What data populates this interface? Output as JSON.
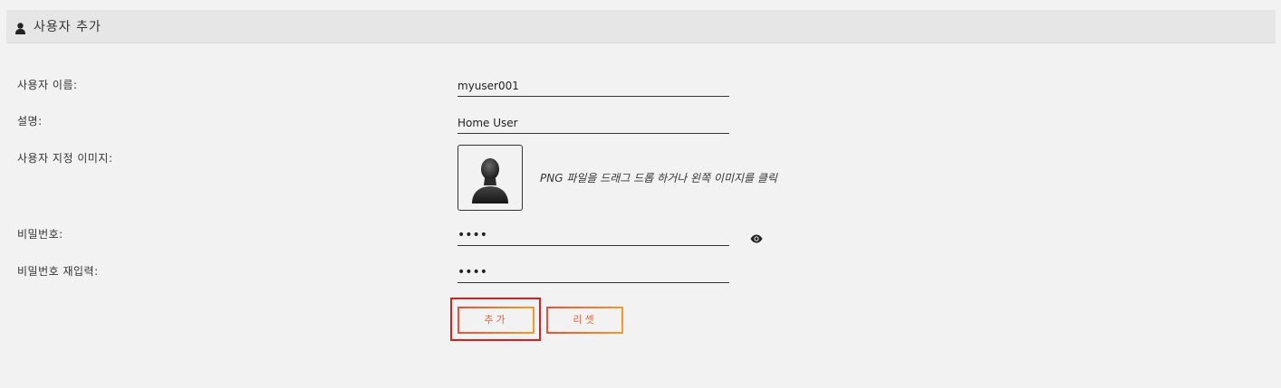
{
  "header": {
    "icon": "user-icon",
    "title": "사용자 추가"
  },
  "form": {
    "username_label": "사용자 이름:",
    "username_value": "myuser001",
    "description_label": "설명:",
    "description_value": "Home User",
    "image_label": "사용자 지정 이미지:",
    "image_icon": "default-avatar-icon",
    "image_hint": "PNG 파일을 드래그 드롭 하거나 왼쪽 이미지를 클릭",
    "password_label": "비밀번호:",
    "password_value": "••••",
    "password_toggle_icon": "eye-icon",
    "password_confirm_label": "비밀번호 재입력:",
    "password_confirm_value": "••••"
  },
  "buttons": {
    "add_label": "추가",
    "reset_label": "리셋"
  },
  "colors": {
    "button_gradient_start": "#e8503a",
    "button_gradient_end": "#f39a2a",
    "highlight": "#d62020"
  }
}
